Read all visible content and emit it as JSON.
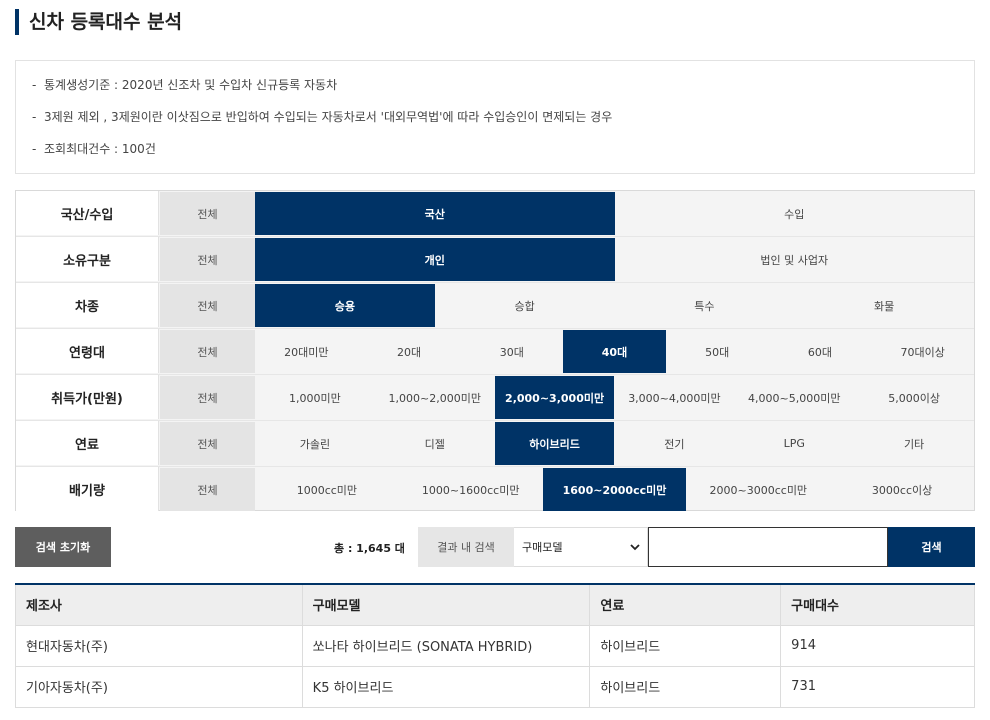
{
  "page": {
    "title": "신차 등록대수 분석"
  },
  "info": {
    "dash": "-",
    "lines": [
      "통계생성기준 : 2020년 신조차 및 수입차 신규등록 자동차",
      "3제원 제외 , 3제원이란 이삿짐으로 반입하여 수입되는 자동차로서 '대외무역법'에 따라 수입승인이 면제되는 경우",
      "조회최대건수 : 100건"
    ]
  },
  "filters": {
    "all_label": "전체",
    "rows": [
      {
        "label": "국산/수입",
        "options": [
          "국산",
          "수입"
        ],
        "selected": 0
      },
      {
        "label": "소유구분",
        "options": [
          "개인",
          "법인 및 사업자"
        ],
        "selected": 0
      },
      {
        "label": "차종",
        "options": [
          "승용",
          "승합",
          "특수",
          "화물"
        ],
        "selected": 0
      },
      {
        "label": "연령대",
        "options": [
          "20대미만",
          "20대",
          "30대",
          "40대",
          "50대",
          "60대",
          "70대이상"
        ],
        "selected": 3
      },
      {
        "label": "취득가(만원)",
        "options": [
          "1,000미만",
          "1,000~2,000미만",
          "2,000~3,000미만",
          "3,000~4,000미만",
          "4,000~5,000미만",
          "5,000이상"
        ],
        "selected": 2
      },
      {
        "label": "연료",
        "options": [
          "가솔린",
          "디젤",
          "하이브리드",
          "전기",
          "LPG",
          "기타"
        ],
        "selected": 2
      },
      {
        "label": "배기량",
        "options": [
          "1000cc미만",
          "1000~1600cc미만",
          "1600~2000cc미만",
          "2000~3000cc미만",
          "3000cc이상"
        ],
        "selected": 2
      }
    ]
  },
  "search": {
    "reset_label": "검색 초기화",
    "total_text": "총 : 1,645 대",
    "result_label": "결과 내 검색",
    "select_value": "구매모델",
    "input_value": "",
    "button_label": "검색"
  },
  "table": {
    "headers": [
      "제조사",
      "구매모델",
      "연료",
      "구매대수"
    ],
    "rows": [
      [
        "현대자동차(주)",
        "쏘나타 하이브리드 (SONATA HYBRID)",
        "하이브리드",
        "914"
      ],
      [
        "기아자동차(주)",
        "K5 하이브리드",
        "하이브리드",
        "731"
      ]
    ]
  },
  "colors": {
    "accent": "#003366",
    "reset": "#5e5e5e"
  }
}
